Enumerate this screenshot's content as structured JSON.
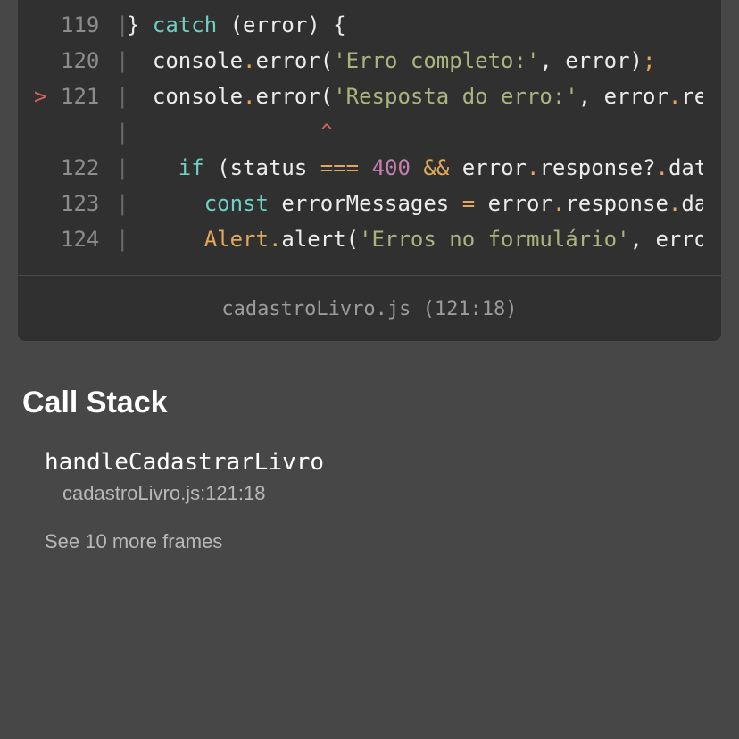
{
  "code_frame": {
    "current_line_marker": ">",
    "lines": [
      {
        "number": "119",
        "gutter": "|",
        "tokens": [
          {
            "t": "} ",
            "c": "pl"
          },
          {
            "t": "catch",
            "c": "kw"
          },
          {
            "t": " (error) {",
            "c": "pl"
          }
        ]
      },
      {
        "number": "120",
        "gutter": "|",
        "tokens": [
          {
            "t": "  console",
            "c": "pl"
          },
          {
            "t": ".",
            "c": "op"
          },
          {
            "t": "error(",
            "c": "pl"
          },
          {
            "t": "'Erro completo:'",
            "c": "str"
          },
          {
            "t": ", error)",
            "c": "pl"
          },
          {
            "t": ";",
            "c": "op"
          }
        ]
      },
      {
        "number": "121",
        "gutter": "|",
        "current": true,
        "tokens": [
          {
            "t": "  console",
            "c": "pl"
          },
          {
            "t": ".",
            "c": "op"
          },
          {
            "t": "error(",
            "c": "pl"
          },
          {
            "t": "'Resposta do erro:'",
            "c": "str"
          },
          {
            "t": ", error",
            "c": "pl"
          },
          {
            "t": ".",
            "c": "op"
          },
          {
            "t": "re",
            "c": "pl"
          }
        ]
      },
      {
        "number": "",
        "gutter": "|",
        "tokens": [
          {
            "t": "               ",
            "c": "pl"
          },
          {
            "t": "^",
            "c": "caret-c"
          }
        ]
      },
      {
        "number": "122",
        "gutter": "|",
        "tokens": [
          {
            "t": "    ",
            "c": "pl"
          },
          {
            "t": "if",
            "c": "kw"
          },
          {
            "t": " (status ",
            "c": "pl"
          },
          {
            "t": "===",
            "c": "op"
          },
          {
            "t": " ",
            "c": "pl"
          },
          {
            "t": "400",
            "c": "num"
          },
          {
            "t": " ",
            "c": "pl"
          },
          {
            "t": "&&",
            "c": "op"
          },
          {
            "t": " error",
            "c": "pl"
          },
          {
            "t": ".",
            "c": "op"
          },
          {
            "t": "response?",
            "c": "pl"
          },
          {
            "t": ".",
            "c": "op"
          },
          {
            "t": "dat",
            "c": "pl"
          }
        ]
      },
      {
        "number": "123",
        "gutter": "|",
        "tokens": [
          {
            "t": "      ",
            "c": "pl"
          },
          {
            "t": "const",
            "c": "kw"
          },
          {
            "t": " errorMessages ",
            "c": "pl"
          },
          {
            "t": "=",
            "c": "op"
          },
          {
            "t": " error",
            "c": "pl"
          },
          {
            "t": ".",
            "c": "op"
          },
          {
            "t": "response",
            "c": "pl"
          },
          {
            "t": ".",
            "c": "op"
          },
          {
            "t": "da",
            "c": "pl"
          }
        ]
      },
      {
        "number": "124",
        "gutter": "|",
        "tokens": [
          {
            "t": "      ",
            "c": "pl"
          },
          {
            "t": "Alert",
            "c": "op"
          },
          {
            "t": ".",
            "c": "op"
          },
          {
            "t": "alert(",
            "c": "pl"
          },
          {
            "t": "'Erros no formulário'",
            "c": "str"
          },
          {
            "t": ", erro",
            "c": "pl"
          }
        ]
      }
    ],
    "file_location": "cadastroLivro.js (121:18)"
  },
  "call_stack": {
    "title": "Call Stack",
    "frames": [
      {
        "name": "handleCadastrarLivro",
        "location": "cadastroLivro.js:121:18"
      }
    ],
    "see_more_label": "See 10 more frames"
  },
  "colors": {
    "background": "#474747",
    "code_background": "#303030",
    "keyword": "#6fcfc2",
    "string": "#a8b57c",
    "number": "#c47fb1",
    "operator": "#e2a85a",
    "error_marker": "#d3625d"
  }
}
